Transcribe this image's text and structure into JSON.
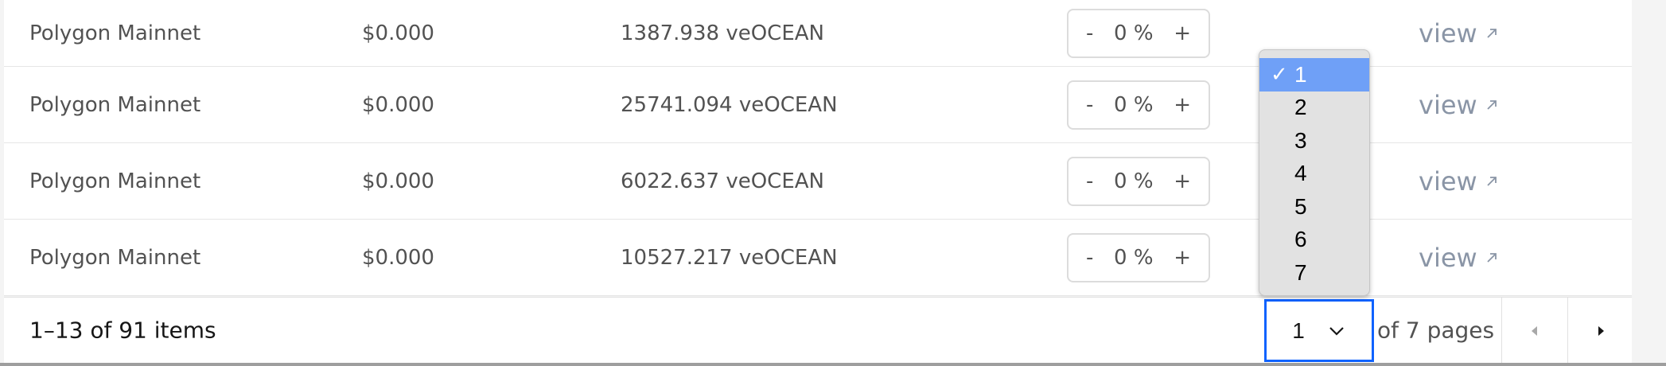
{
  "rows": [
    {
      "network": "Polygon Mainnet",
      "price": "$0.000",
      "allocation": "1387.938 veOCEAN",
      "minus": "-",
      "percent": "0 %",
      "plus": "+",
      "view": "view"
    },
    {
      "network": "Polygon Mainnet",
      "price": "$0.000",
      "allocation": "25741.094 veOCEAN",
      "minus": "-",
      "percent": "0 %",
      "plus": "+",
      "view": "view"
    },
    {
      "network": "Polygon Mainnet",
      "price": "$0.000",
      "allocation": "6022.637 veOCEAN",
      "minus": "-",
      "percent": "0 %",
      "plus": "+",
      "view": "view"
    },
    {
      "network": "Polygon Mainnet",
      "price": "$0.000",
      "allocation": "10527.217 veOCEAN",
      "minus": "-",
      "percent": "0 %",
      "plus": "+",
      "view": "view"
    }
  ],
  "pagination": {
    "items_text": "1–13 of 91 items",
    "current_page": "1",
    "of_pages": "of 7 pages",
    "options": [
      "1",
      "2",
      "3",
      "4",
      "5",
      "6",
      "7"
    ],
    "check": "✓"
  },
  "icons": {
    "external_link": "external-link-icon",
    "chevron": "chevron-down-icon",
    "prev": "caret-left-icon",
    "next": "caret-right-icon"
  },
  "colors": {
    "accent": "#0f62fe",
    "selected_option": "#6fa0f7",
    "link": "#8a95a6"
  }
}
